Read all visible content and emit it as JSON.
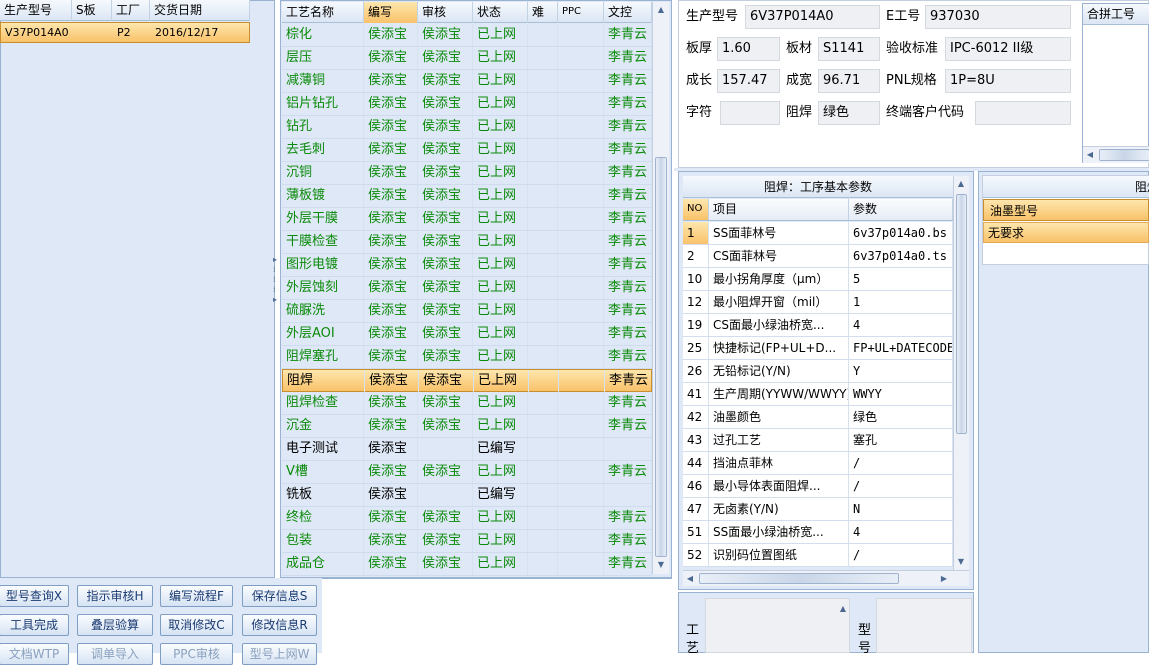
{
  "left_grid": {
    "headers": [
      "生产型号",
      "S板",
      "工厂",
      "交货日期"
    ],
    "rows": [
      {
        "model": "V37P014A0",
        "s": "",
        "factory": "P2",
        "date": "2016/12/17"
      }
    ]
  },
  "process_grid": {
    "headers": [
      "工艺名称",
      "编写",
      "审核",
      "状态",
      "难",
      "PPC",
      "文控"
    ],
    "rows": [
      {
        "name": "棕化",
        "writer": "侯添宝",
        "reviewer": "侯添宝",
        "status": "已上网",
        "doc": "李青云",
        "green": true
      },
      {
        "name": "层压",
        "writer": "侯添宝",
        "reviewer": "侯添宝",
        "status": "已上网",
        "doc": "李青云",
        "green": true
      },
      {
        "name": "减薄铜",
        "writer": "侯添宝",
        "reviewer": "侯添宝",
        "status": "已上网",
        "doc": "李青云",
        "green": true
      },
      {
        "name": "铝片钻孔",
        "writer": "侯添宝",
        "reviewer": "侯添宝",
        "status": "已上网",
        "doc": "李青云",
        "green": true
      },
      {
        "name": "钻孔",
        "writer": "侯添宝",
        "reviewer": "侯添宝",
        "status": "已上网",
        "doc": "李青云",
        "green": true
      },
      {
        "name": "去毛刺",
        "writer": "侯添宝",
        "reviewer": "侯添宝",
        "status": "已上网",
        "doc": "李青云",
        "green": true
      },
      {
        "name": "沉铜",
        "writer": "侯添宝",
        "reviewer": "侯添宝",
        "status": "已上网",
        "doc": "李青云",
        "green": true
      },
      {
        "name": "薄板镀",
        "writer": "侯添宝",
        "reviewer": "侯添宝",
        "status": "已上网",
        "doc": "李青云",
        "green": true
      },
      {
        "name": "外层干膜",
        "writer": "侯添宝",
        "reviewer": "侯添宝",
        "status": "已上网",
        "doc": "李青云",
        "green": true
      },
      {
        "name": "干膜检查",
        "writer": "侯添宝",
        "reviewer": "侯添宝",
        "status": "已上网",
        "doc": "李青云",
        "green": true
      },
      {
        "name": "图形电镀",
        "writer": "侯添宝",
        "reviewer": "侯添宝",
        "status": "已上网",
        "doc": "李青云",
        "green": true
      },
      {
        "name": "外层蚀刻",
        "writer": "侯添宝",
        "reviewer": "侯添宝",
        "status": "已上网",
        "doc": "李青云",
        "green": true
      },
      {
        "name": "硫脲洗",
        "writer": "侯添宝",
        "reviewer": "侯添宝",
        "status": "已上网",
        "doc": "李青云",
        "green": true
      },
      {
        "name": "外层AOI",
        "writer": "侯添宝",
        "reviewer": "侯添宝",
        "status": "已上网",
        "doc": "李青云",
        "green": true
      },
      {
        "name": "阻焊塞孔",
        "writer": "侯添宝",
        "reviewer": "侯添宝",
        "status": "已上网",
        "doc": "李青云",
        "green": true
      },
      {
        "name": "阻焊",
        "writer": "侯添宝",
        "reviewer": "侯添宝",
        "status": "已上网",
        "doc": "李青云",
        "green": false,
        "selected": true
      },
      {
        "name": "阻焊检查",
        "writer": "侯添宝",
        "reviewer": "侯添宝",
        "status": "已上网",
        "doc": "李青云",
        "green": true
      },
      {
        "name": "沉金",
        "writer": "侯添宝",
        "reviewer": "侯添宝",
        "status": "已上网",
        "doc": "李青云",
        "green": true
      },
      {
        "name": "电子测试",
        "writer": "侯添宝",
        "reviewer": "",
        "status": "已编写",
        "doc": "",
        "green": false
      },
      {
        "name": "V槽",
        "writer": "侯添宝",
        "reviewer": "侯添宝",
        "status": "已上网",
        "doc": "李青云",
        "green": true
      },
      {
        "name": "铣板",
        "writer": "侯添宝",
        "reviewer": "",
        "status": "已编写",
        "doc": "",
        "green": false
      },
      {
        "name": "终检",
        "writer": "侯添宝",
        "reviewer": "侯添宝",
        "status": "已上网",
        "doc": "李青云",
        "green": true
      },
      {
        "name": "包装",
        "writer": "侯添宝",
        "reviewer": "侯添宝",
        "status": "已上网",
        "doc": "李青云",
        "green": true
      },
      {
        "name": "成品仓",
        "writer": "侯添宝",
        "reviewer": "侯添宝",
        "status": "已上网",
        "doc": "李青云",
        "green": true
      }
    ]
  },
  "info": {
    "prod_model_label": "生产型号",
    "prod_model": "6V37P014A0",
    "e_no_label": "E工号",
    "e_no": "937030",
    "thickness_label": "板厚",
    "thickness": "1.60",
    "material_label": "板材",
    "material": "S1141",
    "standard_label": "验收标准",
    "standard": "IPC-6012 II级",
    "length_label": "成长",
    "length": "157.47",
    "width_label": "成宽",
    "width": "96.71",
    "pnl_label": "PNL规格",
    "pnl": "1P=8U",
    "char_label": "字符",
    "char": "",
    "mask_label": "阻焊",
    "mask": "绿色",
    "end_customer_label": "终端客户代码",
    "end_customer": "",
    "combined_label": "合拼工号"
  },
  "params": {
    "title": "阻焊：工序基本参数",
    "headers": [
      "NO",
      "项目",
      "参数"
    ],
    "rows": [
      {
        "no": "1",
        "item": "SS面菲林号",
        "value": "6v37p014a0.bs",
        "selected": true
      },
      {
        "no": "2",
        "item": "CS面菲林号",
        "value": "6v37p014a0.ts"
      },
      {
        "no": "10",
        "item": "最小拐角厚度（μm）",
        "value": "5"
      },
      {
        "no": "12",
        "item": "最小阻焊开窗（mil）",
        "value": "1"
      },
      {
        "no": "19",
        "item": "CS面最小绿油桥宽...",
        "value": "4"
      },
      {
        "no": "25",
        "item": "快捷标记(FP+UL+D...",
        "value": "FP+UL+DATECODE"
      },
      {
        "no": "26",
        "item": "无铅标记(Y/N)",
        "value": "Y"
      },
      {
        "no": "41",
        "item": "生产周期(YYWW/WWYY)",
        "value": "WWYY"
      },
      {
        "no": "42",
        "item": "油墨颜色",
        "value": "绿色"
      },
      {
        "no": "43",
        "item": "过孔工艺",
        "value": "塞孔"
      },
      {
        "no": "44",
        "item": "挡油点菲林",
        "value": "/"
      },
      {
        "no": "46",
        "item": "最小导体表面阻焊...",
        "value": "/"
      },
      {
        "no": "47",
        "item": "无卤素(Y/N)",
        "value": "N"
      },
      {
        "no": "51",
        "item": "SS面最小绿油桥宽...",
        "value": "4"
      },
      {
        "no": "52",
        "item": "识别码位置图纸",
        "value": "/"
      }
    ]
  },
  "mask_panel": {
    "title": "阻焊",
    "header": "油墨型号",
    "rows": [
      "无要求"
    ]
  },
  "buttons": [
    [
      "型号查询X",
      "指示审核H",
      "编写流程F",
      "保存信息S"
    ],
    [
      "工具完成",
      "叠层验算",
      "取消修改C",
      "修改信息R"
    ],
    [
      "文档WTP",
      "调单导入",
      "PPC审核",
      "型号上网W"
    ]
  ],
  "bottom_labels": {
    "process_label": "工艺",
    "model_label": "型号"
  }
}
